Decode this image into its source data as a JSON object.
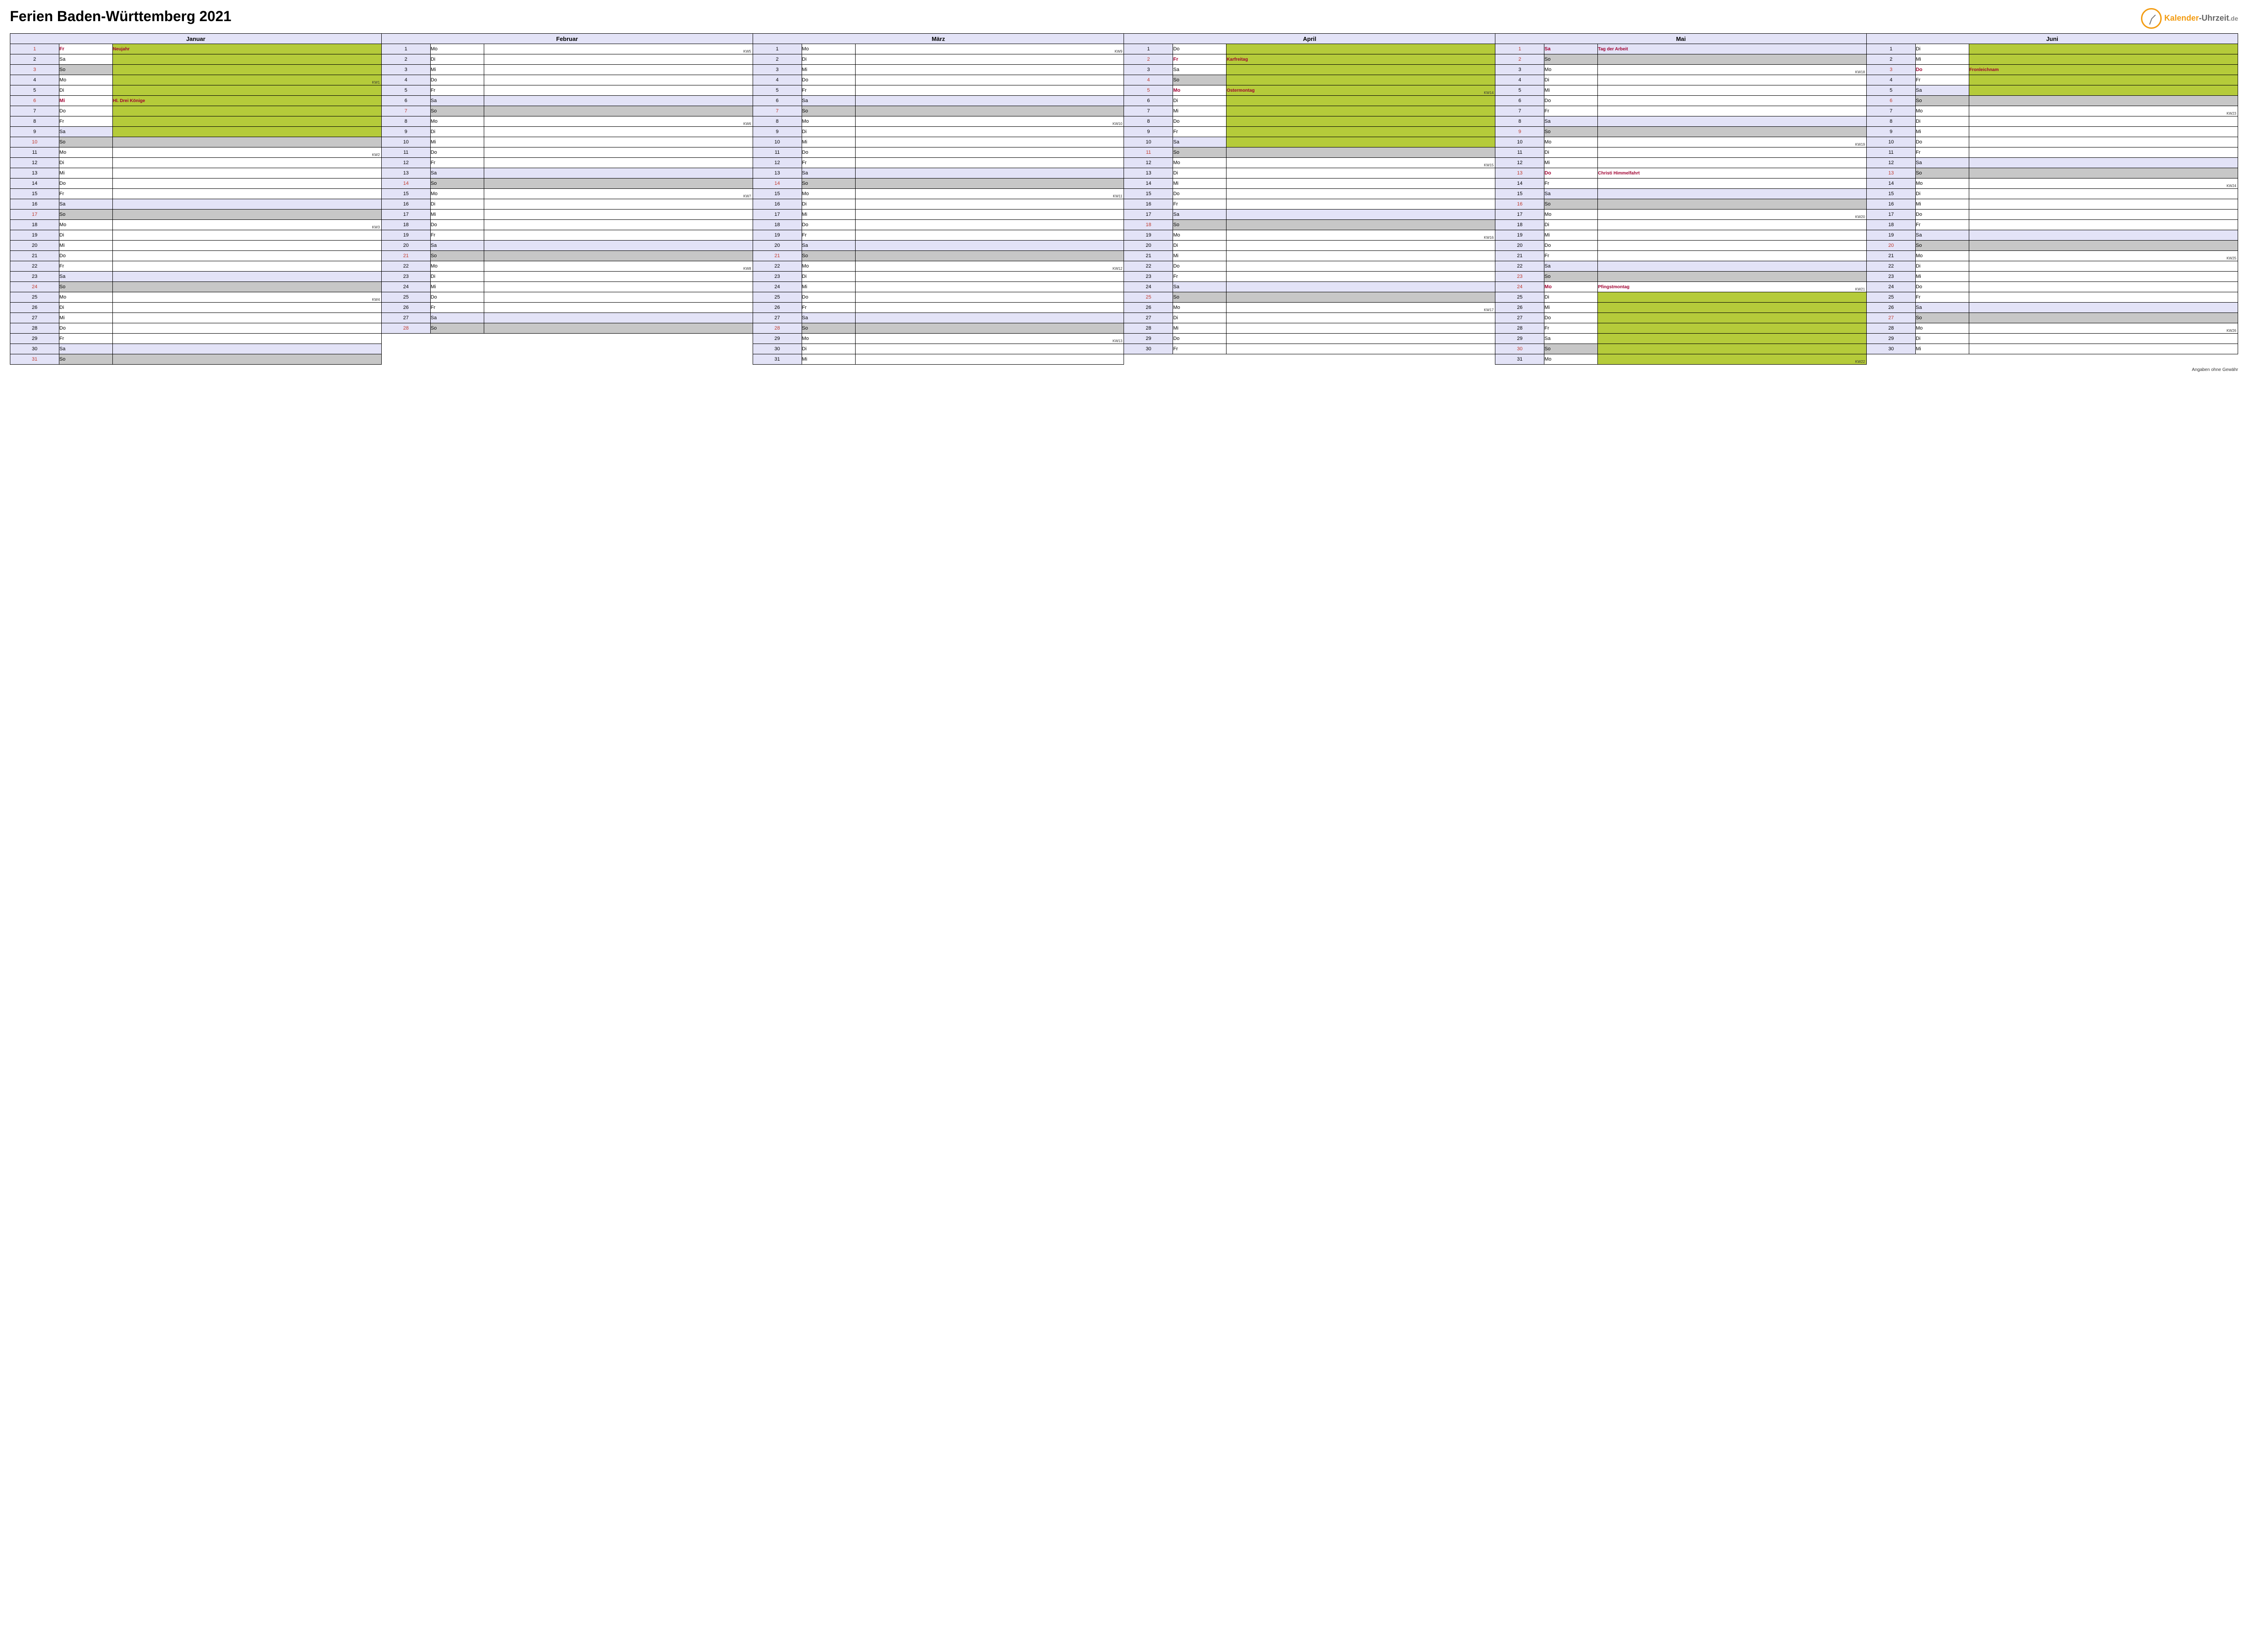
{
  "title": "Ferien Baden-Württemberg 2021",
  "logo": {
    "brand_k": "Kalender",
    "dash": "-",
    "brand_u": "Uhrzeit",
    "tld": ".de"
  },
  "footnote": "Angaben ohne Gewähr",
  "months": [
    "Januar",
    "Februar",
    "März",
    "April",
    "Mai",
    "Juni"
  ],
  "days": {
    "Januar": [
      {
        "n": 1,
        "wd": "Fr",
        "ev": "Neujahr",
        "holiday": true,
        "ferien": true
      },
      {
        "n": 2,
        "wd": "Sa",
        "ferien": true
      },
      {
        "n": 3,
        "wd": "So",
        "sun": true,
        "ferien": true
      },
      {
        "n": 4,
        "wd": "Mo",
        "ferien": true,
        "kw": "KW1"
      },
      {
        "n": 5,
        "wd": "Di",
        "ferien": true
      },
      {
        "n": 6,
        "wd": "Mi",
        "ev": "Hl. Drei Könige",
        "holiday": true,
        "ferien": true
      },
      {
        "n": 7,
        "wd": "Do",
        "ferien": true
      },
      {
        "n": 8,
        "wd": "Fr",
        "ferien": true
      },
      {
        "n": 9,
        "wd": "Sa",
        "sat": true,
        "ferien": true
      },
      {
        "n": 10,
        "wd": "So",
        "sun": true
      },
      {
        "n": 11,
        "wd": "Mo",
        "kw": "KW2"
      },
      {
        "n": 12,
        "wd": "Di"
      },
      {
        "n": 13,
        "wd": "Mi"
      },
      {
        "n": 14,
        "wd": "Do"
      },
      {
        "n": 15,
        "wd": "Fr"
      },
      {
        "n": 16,
        "wd": "Sa",
        "sat": true
      },
      {
        "n": 17,
        "wd": "So",
        "sun": true
      },
      {
        "n": 18,
        "wd": "Mo",
        "kw": "KW3"
      },
      {
        "n": 19,
        "wd": "Di"
      },
      {
        "n": 20,
        "wd": "Mi"
      },
      {
        "n": 21,
        "wd": "Do"
      },
      {
        "n": 22,
        "wd": "Fr"
      },
      {
        "n": 23,
        "wd": "Sa",
        "sat": true
      },
      {
        "n": 24,
        "wd": "So",
        "sun": true
      },
      {
        "n": 25,
        "wd": "Mo",
        "kw": "KW4"
      },
      {
        "n": 26,
        "wd": "Di"
      },
      {
        "n": 27,
        "wd": "Mi"
      },
      {
        "n": 28,
        "wd": "Do"
      },
      {
        "n": 29,
        "wd": "Fr"
      },
      {
        "n": 30,
        "wd": "Sa",
        "sat": true
      },
      {
        "n": 31,
        "wd": "So",
        "sun": true
      }
    ],
    "Februar": [
      {
        "n": 1,
        "wd": "Mo",
        "kw": "KW5"
      },
      {
        "n": 2,
        "wd": "Di"
      },
      {
        "n": 3,
        "wd": "Mi"
      },
      {
        "n": 4,
        "wd": "Do"
      },
      {
        "n": 5,
        "wd": "Fr"
      },
      {
        "n": 6,
        "wd": "Sa",
        "sat": true
      },
      {
        "n": 7,
        "wd": "So",
        "sun": true
      },
      {
        "n": 8,
        "wd": "Mo",
        "kw": "KW6"
      },
      {
        "n": 9,
        "wd": "Di"
      },
      {
        "n": 10,
        "wd": "Mi"
      },
      {
        "n": 11,
        "wd": "Do"
      },
      {
        "n": 12,
        "wd": "Fr"
      },
      {
        "n": 13,
        "wd": "Sa",
        "sat": true
      },
      {
        "n": 14,
        "wd": "So",
        "sun": true
      },
      {
        "n": 15,
        "wd": "Mo",
        "kw": "KW7"
      },
      {
        "n": 16,
        "wd": "Di"
      },
      {
        "n": 17,
        "wd": "Mi"
      },
      {
        "n": 18,
        "wd": "Do"
      },
      {
        "n": 19,
        "wd": "Fr"
      },
      {
        "n": 20,
        "wd": "Sa",
        "sat": true
      },
      {
        "n": 21,
        "wd": "So",
        "sun": true
      },
      {
        "n": 22,
        "wd": "Mo",
        "kw": "KW8"
      },
      {
        "n": 23,
        "wd": "Di"
      },
      {
        "n": 24,
        "wd": "Mi"
      },
      {
        "n": 25,
        "wd": "Do"
      },
      {
        "n": 26,
        "wd": "Fr"
      },
      {
        "n": 27,
        "wd": "Sa",
        "sat": true
      },
      {
        "n": 28,
        "wd": "So",
        "sun": true
      }
    ],
    "März": [
      {
        "n": 1,
        "wd": "Mo",
        "kw": "KW9"
      },
      {
        "n": 2,
        "wd": "Di"
      },
      {
        "n": 3,
        "wd": "Mi"
      },
      {
        "n": 4,
        "wd": "Do"
      },
      {
        "n": 5,
        "wd": "Fr"
      },
      {
        "n": 6,
        "wd": "Sa",
        "sat": true
      },
      {
        "n": 7,
        "wd": "So",
        "sun": true
      },
      {
        "n": 8,
        "wd": "Mo",
        "kw": "KW10"
      },
      {
        "n": 9,
        "wd": "Di"
      },
      {
        "n": 10,
        "wd": "Mi"
      },
      {
        "n": 11,
        "wd": "Do"
      },
      {
        "n": 12,
        "wd": "Fr"
      },
      {
        "n": 13,
        "wd": "Sa",
        "sat": true
      },
      {
        "n": 14,
        "wd": "So",
        "sun": true
      },
      {
        "n": 15,
        "wd": "Mo",
        "kw": "KW11"
      },
      {
        "n": 16,
        "wd": "Di"
      },
      {
        "n": 17,
        "wd": "Mi"
      },
      {
        "n": 18,
        "wd": "Do"
      },
      {
        "n": 19,
        "wd": "Fr"
      },
      {
        "n": 20,
        "wd": "Sa",
        "sat": true
      },
      {
        "n": 21,
        "wd": "So",
        "sun": true
      },
      {
        "n": 22,
        "wd": "Mo",
        "kw": "KW12"
      },
      {
        "n": 23,
        "wd": "Di"
      },
      {
        "n": 24,
        "wd": "Mi"
      },
      {
        "n": 25,
        "wd": "Do"
      },
      {
        "n": 26,
        "wd": "Fr"
      },
      {
        "n": 27,
        "wd": "Sa",
        "sat": true
      },
      {
        "n": 28,
        "wd": "So",
        "sun": true
      },
      {
        "n": 29,
        "wd": "Mo",
        "kw": "KW13"
      },
      {
        "n": 30,
        "wd": "Di"
      },
      {
        "n": 31,
        "wd": "Mi"
      }
    ],
    "April": [
      {
        "n": 1,
        "wd": "Do",
        "ferien": true
      },
      {
        "n": 2,
        "wd": "Fr",
        "ev": "Karfreitag",
        "holiday": true,
        "ferien": true
      },
      {
        "n": 3,
        "wd": "Sa",
        "ferien": true
      },
      {
        "n": 4,
        "wd": "So",
        "sun": true,
        "ferien": true
      },
      {
        "n": 5,
        "wd": "Mo",
        "ev": "Ostermontag",
        "holiday": true,
        "ferien": true,
        "kw": "KW14"
      },
      {
        "n": 6,
        "wd": "Di",
        "ferien": true
      },
      {
        "n": 7,
        "wd": "Mi",
        "ferien": true
      },
      {
        "n": 8,
        "wd": "Do",
        "ferien": true
      },
      {
        "n": 9,
        "wd": "Fr",
        "ferien": true
      },
      {
        "n": 10,
        "wd": "Sa",
        "sat": true,
        "ferien": true
      },
      {
        "n": 11,
        "wd": "So",
        "sun": true
      },
      {
        "n": 12,
        "wd": "Mo",
        "kw": "KW15"
      },
      {
        "n": 13,
        "wd": "Di"
      },
      {
        "n": 14,
        "wd": "Mi"
      },
      {
        "n": 15,
        "wd": "Do"
      },
      {
        "n": 16,
        "wd": "Fr"
      },
      {
        "n": 17,
        "wd": "Sa",
        "sat": true
      },
      {
        "n": 18,
        "wd": "So",
        "sun": true
      },
      {
        "n": 19,
        "wd": "Mo",
        "kw": "KW16"
      },
      {
        "n": 20,
        "wd": "Di"
      },
      {
        "n": 21,
        "wd": "Mi"
      },
      {
        "n": 22,
        "wd": "Do"
      },
      {
        "n": 23,
        "wd": "Fr"
      },
      {
        "n": 24,
        "wd": "Sa",
        "sat": true
      },
      {
        "n": 25,
        "wd": "So",
        "sun": true
      },
      {
        "n": 26,
        "wd": "Mo",
        "kw": "KW17"
      },
      {
        "n": 27,
        "wd": "Di"
      },
      {
        "n": 28,
        "wd": "Mi"
      },
      {
        "n": 29,
        "wd": "Do"
      },
      {
        "n": 30,
        "wd": "Fr"
      }
    ],
    "Mai": [
      {
        "n": 1,
        "wd": "Sa",
        "ev": "Tag der Arbeit",
        "holiday": true,
        "sat": true
      },
      {
        "n": 2,
        "wd": "So",
        "sun": true
      },
      {
        "n": 3,
        "wd": "Mo",
        "kw": "KW18"
      },
      {
        "n": 4,
        "wd": "Di"
      },
      {
        "n": 5,
        "wd": "Mi"
      },
      {
        "n": 6,
        "wd": "Do"
      },
      {
        "n": 7,
        "wd": "Fr"
      },
      {
        "n": 8,
        "wd": "Sa",
        "sat": true
      },
      {
        "n": 9,
        "wd": "So",
        "sun": true
      },
      {
        "n": 10,
        "wd": "Mo",
        "kw": "KW19"
      },
      {
        "n": 11,
        "wd": "Di"
      },
      {
        "n": 12,
        "wd": "Mi"
      },
      {
        "n": 13,
        "wd": "Do",
        "ev": "Christi Himmelfahrt",
        "holiday": true
      },
      {
        "n": 14,
        "wd": "Fr"
      },
      {
        "n": 15,
        "wd": "Sa",
        "sat": true
      },
      {
        "n": 16,
        "wd": "So",
        "sun": true
      },
      {
        "n": 17,
        "wd": "Mo",
        "kw": "KW20"
      },
      {
        "n": 18,
        "wd": "Di"
      },
      {
        "n": 19,
        "wd": "Mi"
      },
      {
        "n": 20,
        "wd": "Do"
      },
      {
        "n": 21,
        "wd": "Fr"
      },
      {
        "n": 22,
        "wd": "Sa",
        "sat": true
      },
      {
        "n": 23,
        "wd": "So",
        "sun": true
      },
      {
        "n": 24,
        "wd": "Mo",
        "ev": "Pfingstmontag",
        "holiday": true,
        "kw": "KW21"
      },
      {
        "n": 25,
        "wd": "Di",
        "ferien": true
      },
      {
        "n": 26,
        "wd": "Mi",
        "ferien": true
      },
      {
        "n": 27,
        "wd": "Do",
        "ferien": true
      },
      {
        "n": 28,
        "wd": "Fr",
        "ferien": true
      },
      {
        "n": 29,
        "wd": "Sa",
        "ferien": true
      },
      {
        "n": 30,
        "wd": "So",
        "sun": true,
        "ferien": true
      },
      {
        "n": 31,
        "wd": "Mo",
        "ferien": true,
        "kw": "KW22"
      }
    ],
    "Juni": [
      {
        "n": 1,
        "wd": "Di",
        "ferien": true
      },
      {
        "n": 2,
        "wd": "Mi",
        "ferien": true
      },
      {
        "n": 3,
        "wd": "Do",
        "ev": "Fronleichnam",
        "holiday": true,
        "ferien": true
      },
      {
        "n": 4,
        "wd": "Fr",
        "ferien": true
      },
      {
        "n": 5,
        "wd": "Sa",
        "sat": true,
        "ferien": true
      },
      {
        "n": 6,
        "wd": "So",
        "sun": true
      },
      {
        "n": 7,
        "wd": "Mo",
        "kw": "KW23"
      },
      {
        "n": 8,
        "wd": "Di"
      },
      {
        "n": 9,
        "wd": "Mi"
      },
      {
        "n": 10,
        "wd": "Do"
      },
      {
        "n": 11,
        "wd": "Fr"
      },
      {
        "n": 12,
        "wd": "Sa",
        "sat": true
      },
      {
        "n": 13,
        "wd": "So",
        "sun": true
      },
      {
        "n": 14,
        "wd": "Mo",
        "kw": "KW24"
      },
      {
        "n": 15,
        "wd": "Di"
      },
      {
        "n": 16,
        "wd": "Mi"
      },
      {
        "n": 17,
        "wd": "Do"
      },
      {
        "n": 18,
        "wd": "Fr"
      },
      {
        "n": 19,
        "wd": "Sa",
        "sat": true
      },
      {
        "n": 20,
        "wd": "So",
        "sun": true
      },
      {
        "n": 21,
        "wd": "Mo",
        "kw": "KW25"
      },
      {
        "n": 22,
        "wd": "Di"
      },
      {
        "n": 23,
        "wd": "Mi"
      },
      {
        "n": 24,
        "wd": "Do"
      },
      {
        "n": 25,
        "wd": "Fr"
      },
      {
        "n": 26,
        "wd": "Sa",
        "sat": true
      },
      {
        "n": 27,
        "wd": "So",
        "sun": true
      },
      {
        "n": 28,
        "wd": "Mo",
        "kw": "KW26"
      },
      {
        "n": 29,
        "wd": "Di"
      },
      {
        "n": 30,
        "wd": "Mi"
      }
    ]
  }
}
